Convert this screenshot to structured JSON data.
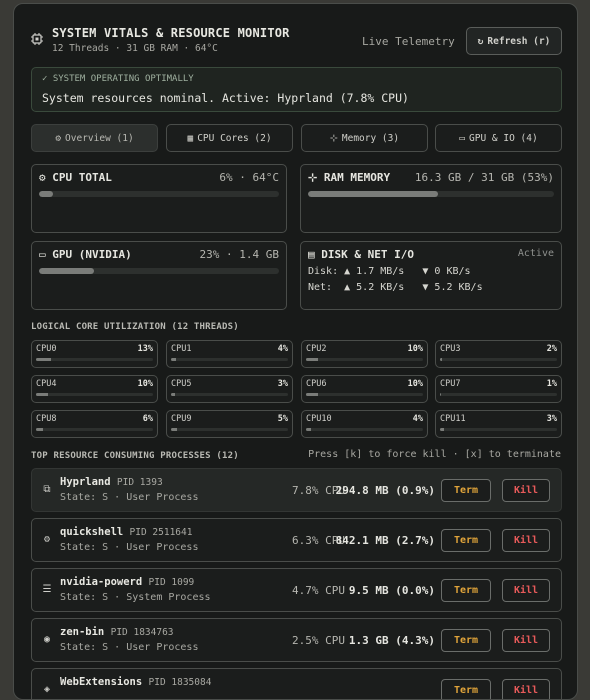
{
  "header": {
    "title": "SYSTEM VITALS & RESOURCE MONITOR",
    "subtitle": "12 Threads · 31 GB RAM · 64°C",
    "live": "Live Telemetry",
    "refresh_label": "Refresh (r)",
    "icon": "cpu-chip-icon"
  },
  "status": {
    "heading": "✓ SYSTEM OPERATING OPTIMALLY",
    "message": "System resources nominal. Active: Hyprland (7.8% CPU)"
  },
  "tabs": [
    {
      "label": "Overview (1)",
      "icon": "⚙"
    },
    {
      "label": "CPU Cores (2)",
      "icon": "▦"
    },
    {
      "label": "Memory (3)",
      "icon": "⊹"
    },
    {
      "label": "GPU & IO (4)",
      "icon": "▭"
    }
  ],
  "cards": {
    "cpu": {
      "icon": "⚙",
      "title": "CPU TOTAL",
      "value": "6% · 64°C",
      "percent": 6
    },
    "ram": {
      "icon": "⊹",
      "title": "RAM MEMORY",
      "value": "16.3 GB / 31 GB (53%)",
      "percent": 53
    },
    "gpu": {
      "icon": "▭",
      "title": "GPU (NVIDIA)",
      "value": "23% · 1.4 GB",
      "percent": 23
    },
    "io": {
      "icon": "▤",
      "title": "DISK & NET I/O",
      "value": "Active",
      "disk_line": "Disk: ▲ 1.7 MB/s   ▼ 0 KB/s",
      "net_line": "Net:  ▲ 5.2 KB/s   ▼ 5.2 KB/s"
    }
  },
  "cores_heading": "LOGICAL CORE UTILIZATION (12 THREADS)",
  "cores": [
    {
      "label": "CPU0",
      "value": "13%",
      "pct": 13
    },
    {
      "label": "CPU1",
      "value": "4%",
      "pct": 4
    },
    {
      "label": "CPU2",
      "value": "10%",
      "pct": 10
    },
    {
      "label": "CPU3",
      "value": "2%",
      "pct": 2
    },
    {
      "label": "CPU4",
      "value": "10%",
      "pct": 10
    },
    {
      "label": "CPU5",
      "value": "3%",
      "pct": 3
    },
    {
      "label": "CPU6",
      "value": "10%",
      "pct": 10
    },
    {
      "label": "CPU7",
      "value": "1%",
      "pct": 1
    },
    {
      "label": "CPU8",
      "value": "6%",
      "pct": 6
    },
    {
      "label": "CPU9",
      "value": "5%",
      "pct": 5
    },
    {
      "label": "CPU10",
      "value": "4%",
      "pct": 4
    },
    {
      "label": "CPU11",
      "value": "3%",
      "pct": 3
    }
  ],
  "processes_heading": "TOP RESOURCE CONSUMING PROCESSES (12)",
  "processes_hint": "Press [k] to force kill · [x] to terminate",
  "term_label": "Term",
  "kill_label": "Kill",
  "processes": [
    {
      "icon": "⧉",
      "name": "Hyprland",
      "pid": "PID 1393",
      "state": "State: S · User Process",
      "cpu": "7.8% CPU",
      "mem": "294.8 MB (0.9%)"
    },
    {
      "icon": "⚙",
      "name": "quickshell",
      "pid": "PID 2511641",
      "state": "State: S · User Process",
      "cpu": "6.3% CPU",
      "mem": "842.1 MB (2.7%)"
    },
    {
      "icon": "☰",
      "name": "nvidia-powerd",
      "pid": "PID 1099",
      "state": "State: S · System Process",
      "cpu": "4.7% CPU",
      "mem": "9.5 MB (0.0%)"
    },
    {
      "icon": "◉",
      "name": "zen-bin",
      "pid": "PID 1834763",
      "state": "State: S · User Process",
      "cpu": "2.5% CPU",
      "mem": "1.3 GB (4.3%)"
    },
    {
      "icon": "◈",
      "name": "WebExtensions",
      "pid": "PID 1835084",
      "state": "",
      "cpu": "",
      "mem": ""
    }
  ]
}
